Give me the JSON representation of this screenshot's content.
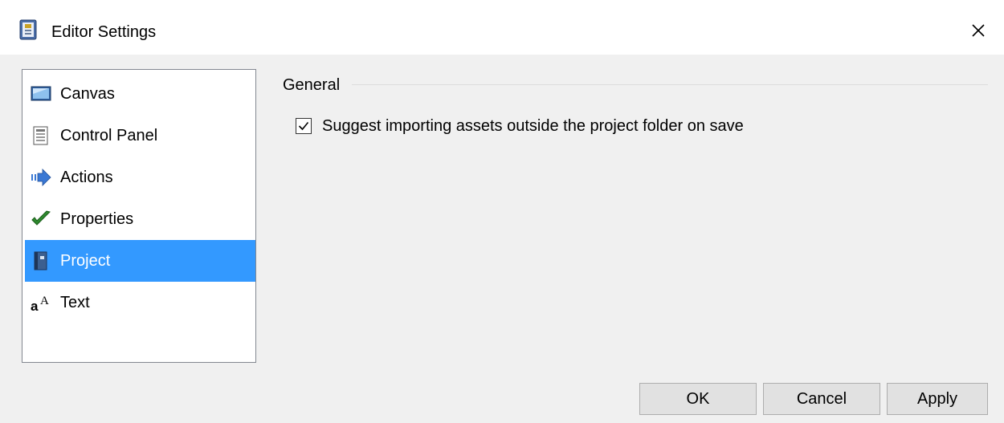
{
  "window": {
    "title": "Editor Settings",
    "icon": "editor-settings-icon",
    "close_icon": "close-icon"
  },
  "sidebar": {
    "items": [
      {
        "label": "Canvas",
        "icon": "canvas-icon",
        "selected": false
      },
      {
        "label": "Control Panel",
        "icon": "control-panel-icon",
        "selected": false
      },
      {
        "label": "Actions",
        "icon": "arrow-right-icon",
        "selected": false
      },
      {
        "label": "Properties",
        "icon": "checkmark-icon",
        "selected": false
      },
      {
        "label": "Project",
        "icon": "project-book-icon",
        "selected": true
      },
      {
        "label": "Text",
        "icon": "text-font-icon",
        "selected": false
      }
    ]
  },
  "general": {
    "title": "General",
    "suggest_import": {
      "label": "Suggest importing assets outside the project folder on save",
      "checked": true
    }
  },
  "buttons": {
    "ok": "OK",
    "cancel": "Cancel",
    "apply": "Apply"
  },
  "colors": {
    "selection": "#3399ff",
    "dialog_bg": "#f0f0f0",
    "button_bg": "#e1e1e1"
  }
}
